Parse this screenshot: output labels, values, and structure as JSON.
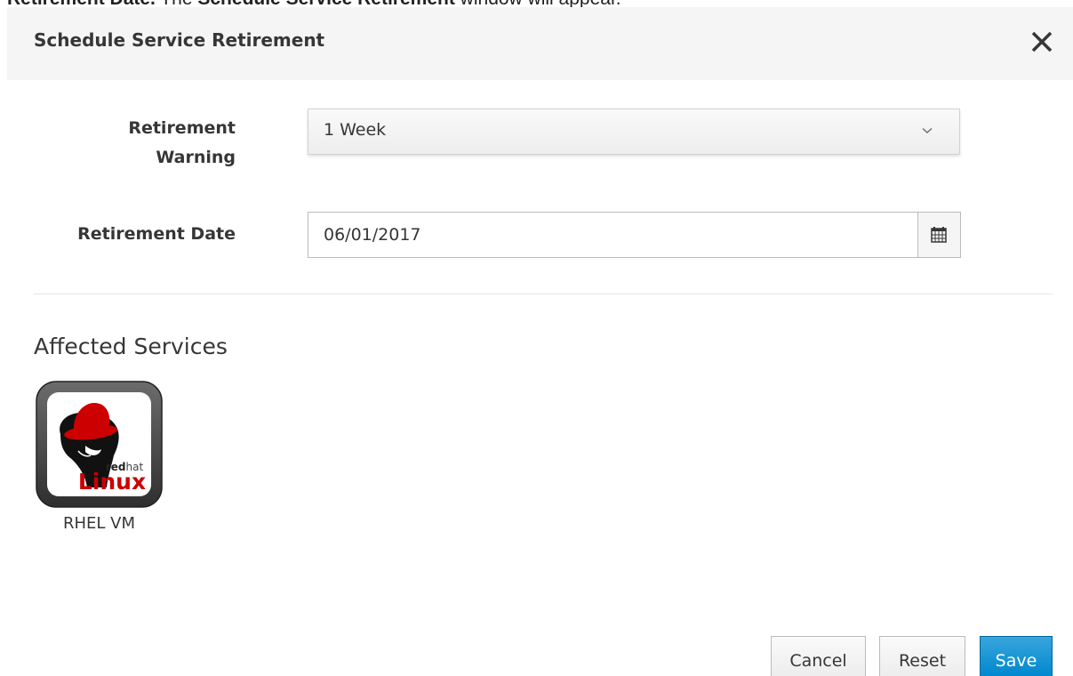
{
  "doc_text": {
    "bold": "Retirement Date.",
    "normal": " The ",
    "bold2": "Schedule Service Retirement",
    "tail": " window will appear."
  },
  "modal": {
    "title": "Schedule Service Retirement",
    "close_icon": "close-icon"
  },
  "form": {
    "warning_label_line1": "Retirement",
    "warning_label_line2": "Warning",
    "warning_value": "1 Week",
    "date_label": "Retirement Date",
    "date_value": "06/01/2017",
    "calendar_icon": "calendar-icon"
  },
  "affected": {
    "title": "Affected Services",
    "items": [
      {
        "name": "RHEL VM",
        "logo_text_top": "redhat",
        "logo_text_bottom": "Linux"
      }
    ]
  },
  "footer": {
    "cancel": "Cancel",
    "reset": "Reset",
    "save": "Save"
  },
  "colors": {
    "primary": "#0088ce",
    "header_bg": "#f5f5f5",
    "logo_red": "#cc0000"
  }
}
